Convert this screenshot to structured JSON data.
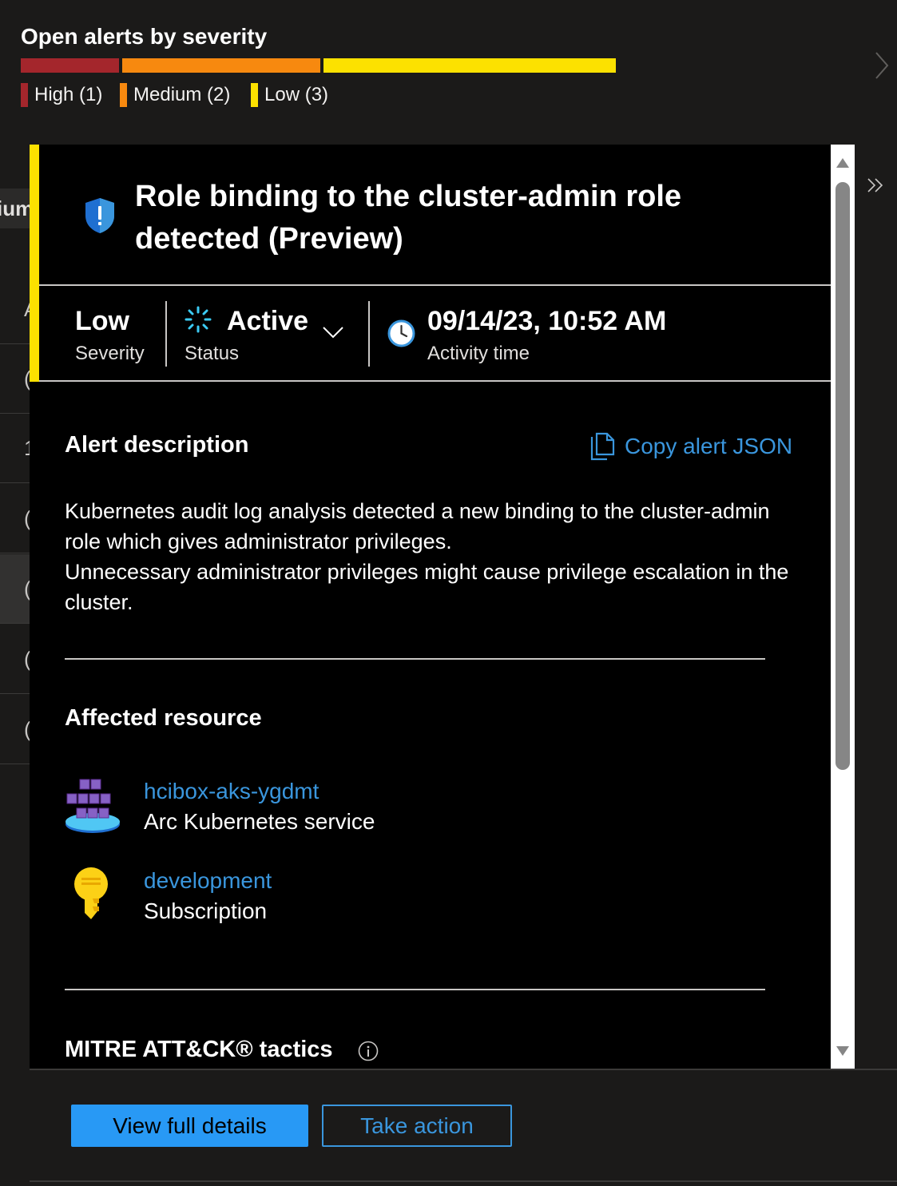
{
  "summary": {
    "title": "Open alerts by severity",
    "severity_bar": [
      {
        "name": "High",
        "count": 1,
        "color": "#a4262c"
      },
      {
        "name": "Medium",
        "count": 2,
        "color": "#f7890f"
      },
      {
        "name": "Low",
        "count": 3,
        "color": "#fce100"
      }
    ],
    "legend": [
      {
        "label": "High (1)",
        "color": "#a4262c"
      },
      {
        "label": "Medium (2)",
        "color": "#f7890f"
      },
      {
        "label": "Low (3)",
        "color": "#fce100"
      }
    ]
  },
  "background_list": {
    "header_fragment": "ium",
    "row_fragments": [
      "A",
      "(",
      "1",
      "(",
      "(",
      "(",
      "("
    ]
  },
  "alert": {
    "title": "Role binding to the cluster-admin role detected (Preview)",
    "severity_value": "Low",
    "severity_label": "Severity",
    "status_value": "Active",
    "status_label": "Status",
    "activity_time_value": "09/14/23, 10:52 AM",
    "activity_time_label": "Activity time",
    "accent_color": "#fce100"
  },
  "description": {
    "heading": "Alert description",
    "copy_label": "Copy alert JSON",
    "paragraph_1": "Kubernetes audit log analysis detected a new binding to the cluster-admin role which gives administrator privileges.",
    "paragraph_2": "Unnecessary administrator privileges might cause privilege escalation in the cluster."
  },
  "affected": {
    "heading": "Affected resource",
    "resources": [
      {
        "name": "hcibox-aks-ygdmt",
        "type": "Arc Kubernetes service",
        "icon": "arc-kubernetes-icon"
      },
      {
        "name": "development",
        "type": "Subscription",
        "icon": "subscription-key-icon"
      }
    ]
  },
  "mitre": {
    "heading": "MITRE ATT&CK® tactics"
  },
  "footer": {
    "view_full_details": "View full details",
    "take_action": "Take action"
  }
}
